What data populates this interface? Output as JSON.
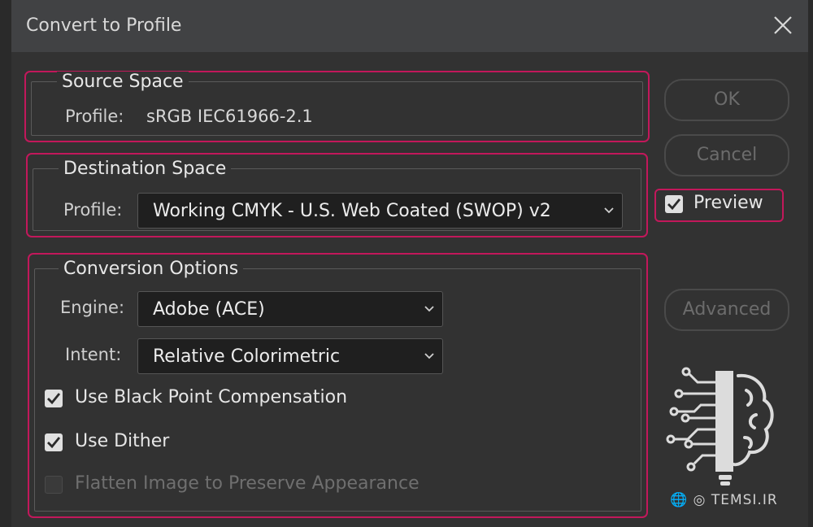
{
  "window": {
    "title": "Convert to Profile"
  },
  "source_space": {
    "legend": "Source Space",
    "profile_label": "Profile:",
    "profile_value": "sRGB IEC61966-2.1"
  },
  "destination_space": {
    "legend": "Destination Space",
    "profile_label": "Profile:",
    "profile_value": "Working CMYK - U.S. Web Coated (SWOP) v2"
  },
  "conversion_options": {
    "legend": "Conversion Options",
    "engine_label": "Engine:",
    "engine_value": "Adobe (ACE)",
    "intent_label": "Intent:",
    "intent_value": "Relative Colorimetric",
    "black_point": {
      "label": "Use Black Point Compensation",
      "checked": true
    },
    "dither": {
      "label": "Use Dither",
      "checked": true
    },
    "flatten": {
      "label": "Flatten Image to Preserve Appearance",
      "checked": false,
      "disabled": true
    }
  },
  "buttons": {
    "ok": "OK",
    "cancel": "Cancel",
    "advanced": "Advanced"
  },
  "preview": {
    "label": "Preview",
    "checked": true
  },
  "watermark": {
    "text": "TEMSI.IR"
  },
  "colors": {
    "highlight": "#c2185b",
    "titlebar": "#414244",
    "dialog": "#323232"
  }
}
